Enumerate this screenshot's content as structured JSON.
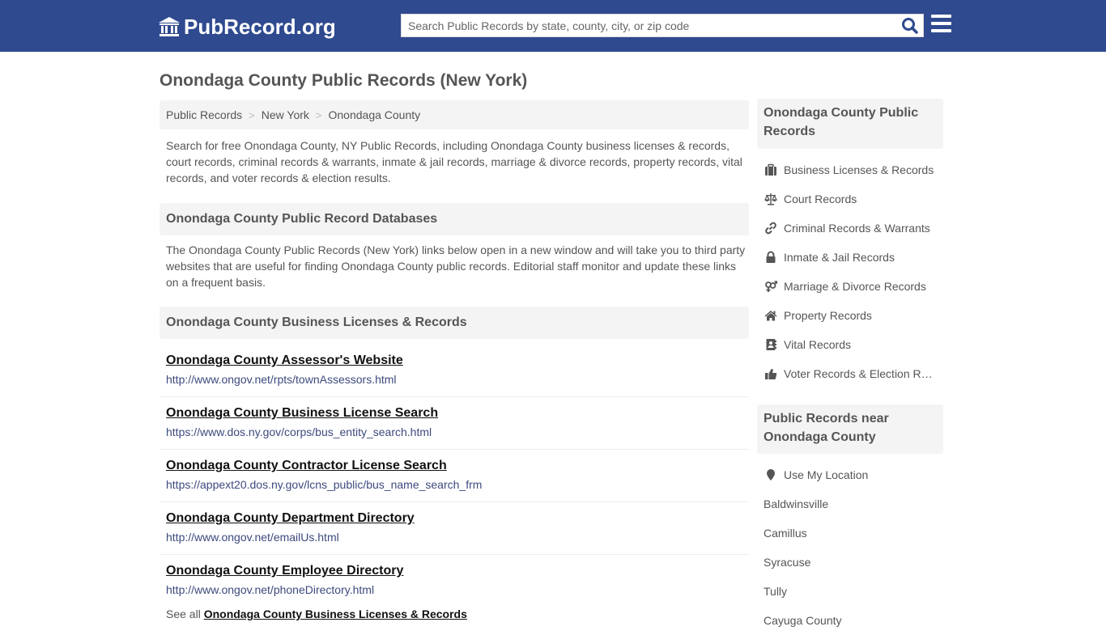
{
  "header": {
    "logo_text": "PubRecord.org",
    "search_placeholder": "Search Public Records by state, county, city, or zip code",
    "brand_color": "#2f4a8f"
  },
  "page_title": "Onondaga County Public Records (New York)",
  "breadcrumb": [
    "Public Records",
    "New York",
    "Onondaga County"
  ],
  "breadcrumb_separator": ">",
  "intro": "Search for free Onondaga County, NY Public Records, including Onondaga County business licenses & records, court records, criminal records & warrants, inmate & jail records, marriage & divorce records, property records, vital records, and voter records & election results.",
  "databases": {
    "heading": "Onondaga County Public Record Databases",
    "description": "The Onondaga County Public Records (New York) links below open in a new window and will take you to third party websites that are useful for finding Onondaga County public records. Editorial staff monitor and update these links on a frequent basis."
  },
  "business": {
    "heading": "Onondaga County Business Licenses & Records",
    "links": [
      {
        "title": "Onondaga County Assessor's Website",
        "url": "http://www.ongov.net/rpts/townAssessors.html"
      },
      {
        "title": "Onondaga County Business License Search",
        "url": "https://www.dos.ny.gov/corps/bus_entity_search.html"
      },
      {
        "title": "Onondaga County Contractor License Search",
        "url": "https://appext20.dos.ny.gov/lcns_public/bus_name_search_frm"
      },
      {
        "title": "Onondaga County Department Directory",
        "url": "http://www.ongov.net/emailUs.html"
      },
      {
        "title": "Onondaga County Employee Directory",
        "url": "http://www.ongov.net/phoneDirectory.html"
      }
    ],
    "see_all_prefix": "See all",
    "see_all_link": "Onondaga County Business Licenses & Records"
  },
  "sidebar": {
    "records_heading": "Onondaga County Public Records",
    "records_items": [
      {
        "icon": "briefcase-icon",
        "label": "Business Licenses & Records"
      },
      {
        "icon": "scale-icon",
        "label": "Court Records"
      },
      {
        "icon": "link-icon",
        "label": "Criminal Records & Warrants"
      },
      {
        "icon": "lock-icon",
        "label": "Inmate & Jail Records"
      },
      {
        "icon": "gender-icon",
        "label": "Marriage & Divorce Records"
      },
      {
        "icon": "home-icon",
        "label": "Property Records"
      },
      {
        "icon": "contact-book-icon",
        "label": "Vital Records"
      },
      {
        "icon": "thumbs-up-icon",
        "label": "Voter Records & Election Results"
      }
    ],
    "nearby_heading": "Public Records near Onondaga County",
    "use_location": "Use My Location",
    "nearby_items": [
      "Baldwinsville",
      "Camillus",
      "Syracuse",
      "Tully",
      "Cayuga County"
    ]
  }
}
